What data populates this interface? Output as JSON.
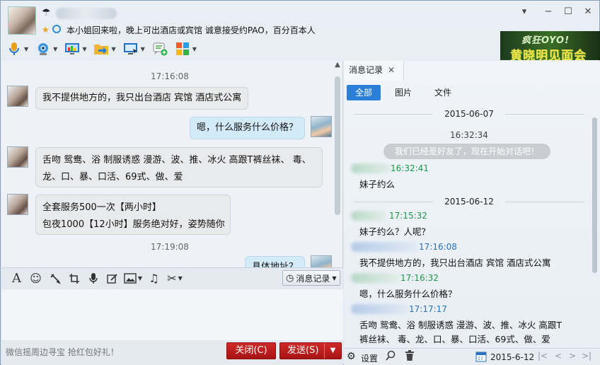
{
  "header": {
    "signature": "本小姐回来啦，晚上可出酒店或宾馆 诚意接受约PAO，百分百本人",
    "window_controls": {
      "menu": "▾",
      "minimize": "−",
      "maximize": "☐",
      "close": "✕"
    }
  },
  "ad": {
    "line1": "疯狂OYO!",
    "line2": "黄晓明见面会"
  },
  "toolbar": {
    "icons": [
      "microphone-icon",
      "video-call-icon",
      "screen-share-icon",
      "file-transfer-icon",
      "remote-desktop-icon",
      "add-app-icon",
      "apps-grid-icon"
    ]
  },
  "chat": {
    "messages": [
      {
        "type": "time",
        "text": "17:16:08"
      },
      {
        "type": "in",
        "lines": [
          "我不提供地方的，我只出台酒店 宾馆 酒店式公寓"
        ]
      },
      {
        "type": "out",
        "lines": [
          "嗯，什么服务什么价格？"
        ]
      },
      {
        "type": "in",
        "lines": [
          "舌吻   鸳鸯、浴 制服诱惑 漫游、波、推、冰火 高跟T裤丝袜、 毒、",
          "龙、口、暴、口活、69式、做、爱"
        ]
      },
      {
        "type": "in",
        "lines": [
          "全套服务500一次【两小时】",
          "包夜1000【12小时】服务绝对好，姿势随你"
        ]
      },
      {
        "type": "time",
        "text": "17:19:08"
      },
      {
        "type": "out",
        "lines": [
          "具体地址？"
        ]
      }
    ]
  },
  "input_toolbar": {
    "history_button": "消息记录",
    "icons": [
      "font-icon",
      "emoji-icon",
      "nudge-icon",
      "screenshot-icon",
      "voice-message-icon",
      "handwriting-icon",
      "image-icon",
      "music-icon",
      "scissors-icon"
    ]
  },
  "footer": {
    "tip": "微信摇周边寻宝 抢红包好礼！",
    "close_label": "关闭(C)",
    "send_label": "发送(S)"
  },
  "history": {
    "tab_label": "消息记录",
    "filters": [
      "全部",
      "图片",
      "文件"
    ],
    "entries": [
      {
        "type": "date",
        "text": "2015-06-07"
      },
      {
        "type": "time",
        "text": "16:32:34"
      },
      {
        "type": "system",
        "text": "我们已经是好友了，现在开始对话吧！"
      },
      {
        "type": "header",
        "color": "green",
        "time": "16:32:41"
      },
      {
        "type": "text",
        "text": "妹子约么"
      },
      {
        "type": "date",
        "text": "2015-06-12"
      },
      {
        "type": "header",
        "color": "green",
        "time": "17:15:32"
      },
      {
        "type": "text",
        "text": "妹子约么？人呢？"
      },
      {
        "type": "header",
        "color": "blue",
        "time": "17:16:08"
      },
      {
        "type": "text",
        "text": "我不提供地方的，我只出台酒店 宾馆 酒店式公寓"
      },
      {
        "type": "header",
        "color": "green",
        "time": "17:16:32"
      },
      {
        "type": "text",
        "text": "嗯，什么服务什么价格？"
      },
      {
        "type": "header",
        "color": "blue",
        "time": "17:17:17"
      },
      {
        "type": "text",
        "text": "舌吻   鸳鸯、浴 制服诱惑 漫游、波、推、冰火 高跟T"
      },
      {
        "type": "text",
        "text": "裤丝袜、 毒、龙、口、暴、口活、69式、做、爱"
      }
    ],
    "footer": {
      "settings_label": "设置",
      "date": "2015-6-12"
    }
  },
  "colors": {
    "accent": "#2c7fd6",
    "send": "#c01e1e",
    "time_green": "#1a9a4a",
    "time_blue": "#2a6fc0"
  }
}
